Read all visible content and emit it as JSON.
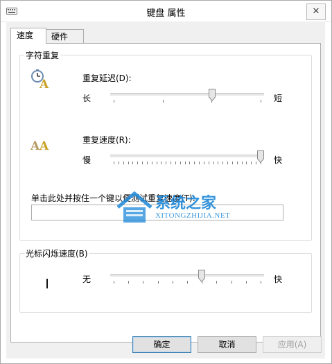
{
  "window": {
    "title": "键盘 属性",
    "close_glyph": "✕"
  },
  "tabs": [
    {
      "label": "速度",
      "active": true
    },
    {
      "label": "硬件",
      "active": false
    }
  ],
  "char_repeat": {
    "group_label": "字符重复",
    "delay": {
      "label": "重复延迟(D):",
      "left": "长",
      "right": "短",
      "level_fraction": 0.67,
      "tick_count": 4
    },
    "rate": {
      "label": "重复速度(R):",
      "left": "慢",
      "right": "快",
      "level_fraction": 1.0,
      "tick_count": 32
    },
    "test": {
      "label": "单击此处并按住一个键以便测试重复速度(T):",
      "value": ""
    }
  },
  "cursor_blink": {
    "group_label": "光标闪烁速度(B)",
    "left": "无",
    "right": "快",
    "level_fraction": 0.6,
    "tick_count": 11
  },
  "buttons": {
    "ok": "确定",
    "cancel": "取消",
    "apply": "应用(A)"
  },
  "watermark": {
    "cn": "系统之家",
    "en": "XITONGZHIJIA.NET"
  },
  "colors": {
    "watermark_blue": "#1e88d9",
    "glyph_gold": "#c9a12a"
  }
}
